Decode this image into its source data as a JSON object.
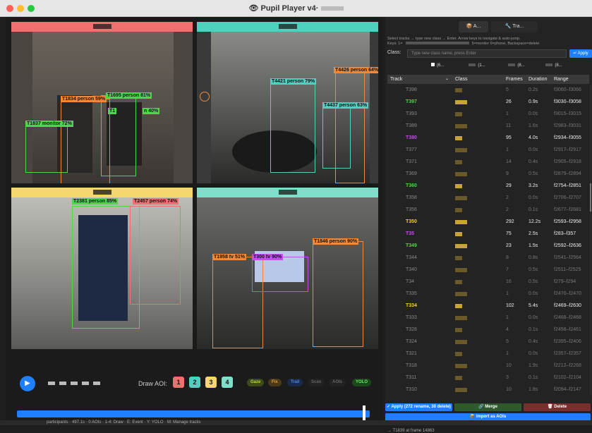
{
  "window": {
    "title": "Pupil Player v4·",
    "colors": {
      "close": "#fe5f57",
      "min": "#febc2e",
      "max": "#28c840"
    }
  },
  "quadrants": [
    {
      "id": 1,
      "color": "#f07070",
      "labels": [
        {
          "text": "T1834 person 59%",
          "color": "#f08a3a"
        },
        {
          "text": "T1695 person 81%",
          "color": "#4bd84b"
        },
        {
          "text": "T1837 monitor 72%",
          "color": "#4bd84b"
        },
        {
          "text": "T1",
          "color": "#4bd84b"
        },
        {
          "text": "n 40%",
          "color": "#4bd84b"
        }
      ]
    },
    {
      "id": 2,
      "color": "#4fd1c0",
      "labels": [
        {
          "text": "T4421 person 79%",
          "color": "#4fd1c0"
        },
        {
          "text": "T4426 person 64%",
          "color": "#f08a3a"
        },
        {
          "text": "T4437 person 63%",
          "color": "#4fd1c0"
        }
      ]
    },
    {
      "id": 3,
      "color": "#f5d76e",
      "labels": [
        {
          "text": "T2381 person 85%",
          "color": "#4bd84b"
        },
        {
          "text": "T2457 person 74%",
          "color": "#f07070"
        }
      ]
    },
    {
      "id": 4,
      "color": "#4fd1c0",
      "labels": [
        {
          "text": "T1846 person 90%",
          "color": "#f08a3a"
        },
        {
          "text": "T1958 tv 51%",
          "color": "#f08a3a"
        },
        {
          "text": "T300 tv 90%",
          "color": "#c050e8"
        }
      ]
    }
  ],
  "controls": {
    "play": "▶",
    "draw_aoi": "Draw AOI:",
    "aoi_buttons": [
      {
        "n": "1",
        "color": "#f07070"
      },
      {
        "n": "2",
        "color": "#4fd1c0"
      },
      {
        "n": "3",
        "color": "#f5d76e"
      },
      {
        "n": "4",
        "color": "#7ee0c8"
      }
    ],
    "pills": [
      {
        "text": "Gaze",
        "bg": "#3d4a1a",
        "fg": "#b8d84a"
      },
      {
        "text": "Fix",
        "bg": "#4a3a1a",
        "fg": "#e8a23a"
      },
      {
        "text": "Trail",
        "bg": "#1a2a4a",
        "fg": "#4a8ae8"
      },
      {
        "text": "Scan",
        "bg": "#222",
        "fg": "#666"
      },
      {
        "text": "AOIs",
        "bg": "#222",
        "fg": "#666"
      },
      {
        "text": "YOLO",
        "bg": "#1a4a1a",
        "fg": "#6ae86a"
      }
    ]
  },
  "status": "participants · 497.1s · 0 AOIs · 1-4: Draw · E: Event · Y: YOLO · M: Manage tracks",
  "panel": {
    "tabs": [
      {
        "text": "📦 A..."
      },
      {
        "text": "🔧 Tra..."
      }
    ],
    "help1": "Select tracks → type new class → Enter. Arrow keys to navigate & auto-jump.",
    "help2": "Keys: 1=",
    "help3": "5=monitor 6=phone, Backspace=delete",
    "class_label": "Class:",
    "class_placeholder": "Type new class name, press Enter",
    "apply": "↵ Apply",
    "chips": [
      "(6...",
      "(1...",
      "(8...",
      "(8..."
    ],
    "headers": {
      "track": "Track",
      "class": "Class",
      "frames": "Frames",
      "duration": "Duration",
      "range": "Range"
    },
    "rows": [
      {
        "track": "T398",
        "frames": "5",
        "dur": "0.2s",
        "range": "f3060–f3066",
        "color": "#888",
        "bright": false
      },
      {
        "track": "T397",
        "frames": "26",
        "dur": "0.9s",
        "range": "f3030–f3058",
        "color": "#4bd84b",
        "bright": true
      },
      {
        "track": "T393",
        "frames": "1",
        "dur": "0.0s",
        "range": "f3015–f3015",
        "color": "#888",
        "bright": false
      },
      {
        "track": "T389",
        "frames": "11",
        "dur": "1.6s",
        "range": "f2983–f3031",
        "color": "#888",
        "bright": false
      },
      {
        "track": "T380",
        "frames": "95",
        "dur": "4.0s",
        "range": "f2934–f3055",
        "color": "#c050e8",
        "bright": true
      },
      {
        "track": "T377",
        "frames": "1",
        "dur": "0.0s",
        "range": "f2917–f2917",
        "color": "#888",
        "bright": false
      },
      {
        "track": "T371",
        "frames": "14",
        "dur": "0.4s",
        "range": "f2905–f2918",
        "color": "#888",
        "bright": false
      },
      {
        "track": "T369",
        "frames": "9",
        "dur": "0.5s",
        "range": "f2879–f2894",
        "color": "#888",
        "bright": false
      },
      {
        "track": "T360",
        "frames": "29",
        "dur": "3.2s",
        "range": "f2754–f2851",
        "color": "#4bd84b",
        "bright": true
      },
      {
        "track": "T358",
        "frames": "2",
        "dur": "0.0s",
        "range": "f2706–f2707",
        "color": "#888",
        "bright": false
      },
      {
        "track": "T356",
        "frames": "2",
        "dur": "0.1s",
        "range": "f2677–f2681",
        "color": "#888",
        "bright": false
      },
      {
        "track": "T350",
        "frames": "292",
        "dur": "12.2s",
        "range": "f2593–f2958",
        "color": "#f5d020",
        "bright": true
      },
      {
        "track": "T35",
        "frames": "75",
        "dur": "2.5s",
        "range": "f283–f357",
        "color": "#c050e8",
        "bright": true
      },
      {
        "track": "T349",
        "frames": "23",
        "dur": "1.5s",
        "range": "f2592–f2636",
        "color": "#4bd84b",
        "bright": true
      },
      {
        "track": "T344",
        "frames": "8",
        "dur": "0.8s",
        "range": "f2541–f2564",
        "color": "#888",
        "bright": false
      },
      {
        "track": "T340",
        "frames": "7",
        "dur": "0.5s",
        "range": "f2511–f2525",
        "color": "#888",
        "bright": false
      },
      {
        "track": "T34",
        "frames": "16",
        "dur": "0.5s",
        "range": "f279–f294",
        "color": "#888",
        "bright": false
      },
      {
        "track": "T335",
        "frames": "1",
        "dur": "0.0s",
        "range": "f2470–f2470",
        "color": "#888",
        "bright": false
      },
      {
        "track": "T334",
        "frames": "102",
        "dur": "5.4s",
        "range": "f2469–f2630",
        "color": "#f5d020",
        "bright": true
      },
      {
        "track": "T333",
        "frames": "1",
        "dur": "0.0s",
        "range": "f2468–f2468",
        "color": "#888",
        "bright": false
      },
      {
        "track": "T328",
        "frames": "4",
        "dur": "0.1s",
        "range": "f2458–f2461",
        "color": "#888",
        "bright": false
      },
      {
        "track": "T324",
        "frames": "5",
        "dur": "0.4s",
        "range": "f2395–f2406",
        "color": "#888",
        "bright": false
      },
      {
        "track": "T321",
        "frames": "1",
        "dur": "0.0s",
        "range": "f2357–f2357",
        "color": "#888",
        "bright": false
      },
      {
        "track": "T318",
        "frames": "10",
        "dur": "1.9s",
        "range": "f2212–f2268",
        "color": "#888",
        "bright": false
      },
      {
        "track": "T311",
        "frames": "3",
        "dur": "0.1s",
        "range": "f2102–f2104",
        "color": "#888",
        "bright": false
      },
      {
        "track": "T310",
        "frames": "10",
        "dur": "1.8s",
        "range": "f2094–f2147",
        "color": "#888",
        "bright": false
      }
    ],
    "apply_all": "✓ Apply (272 rename, 30 delete)",
    "merge": "🔗 Merge",
    "delete": "🗑 Delete",
    "import": "📦 Import as AOIs",
    "event": "→ T1839 at frame 14863"
  }
}
